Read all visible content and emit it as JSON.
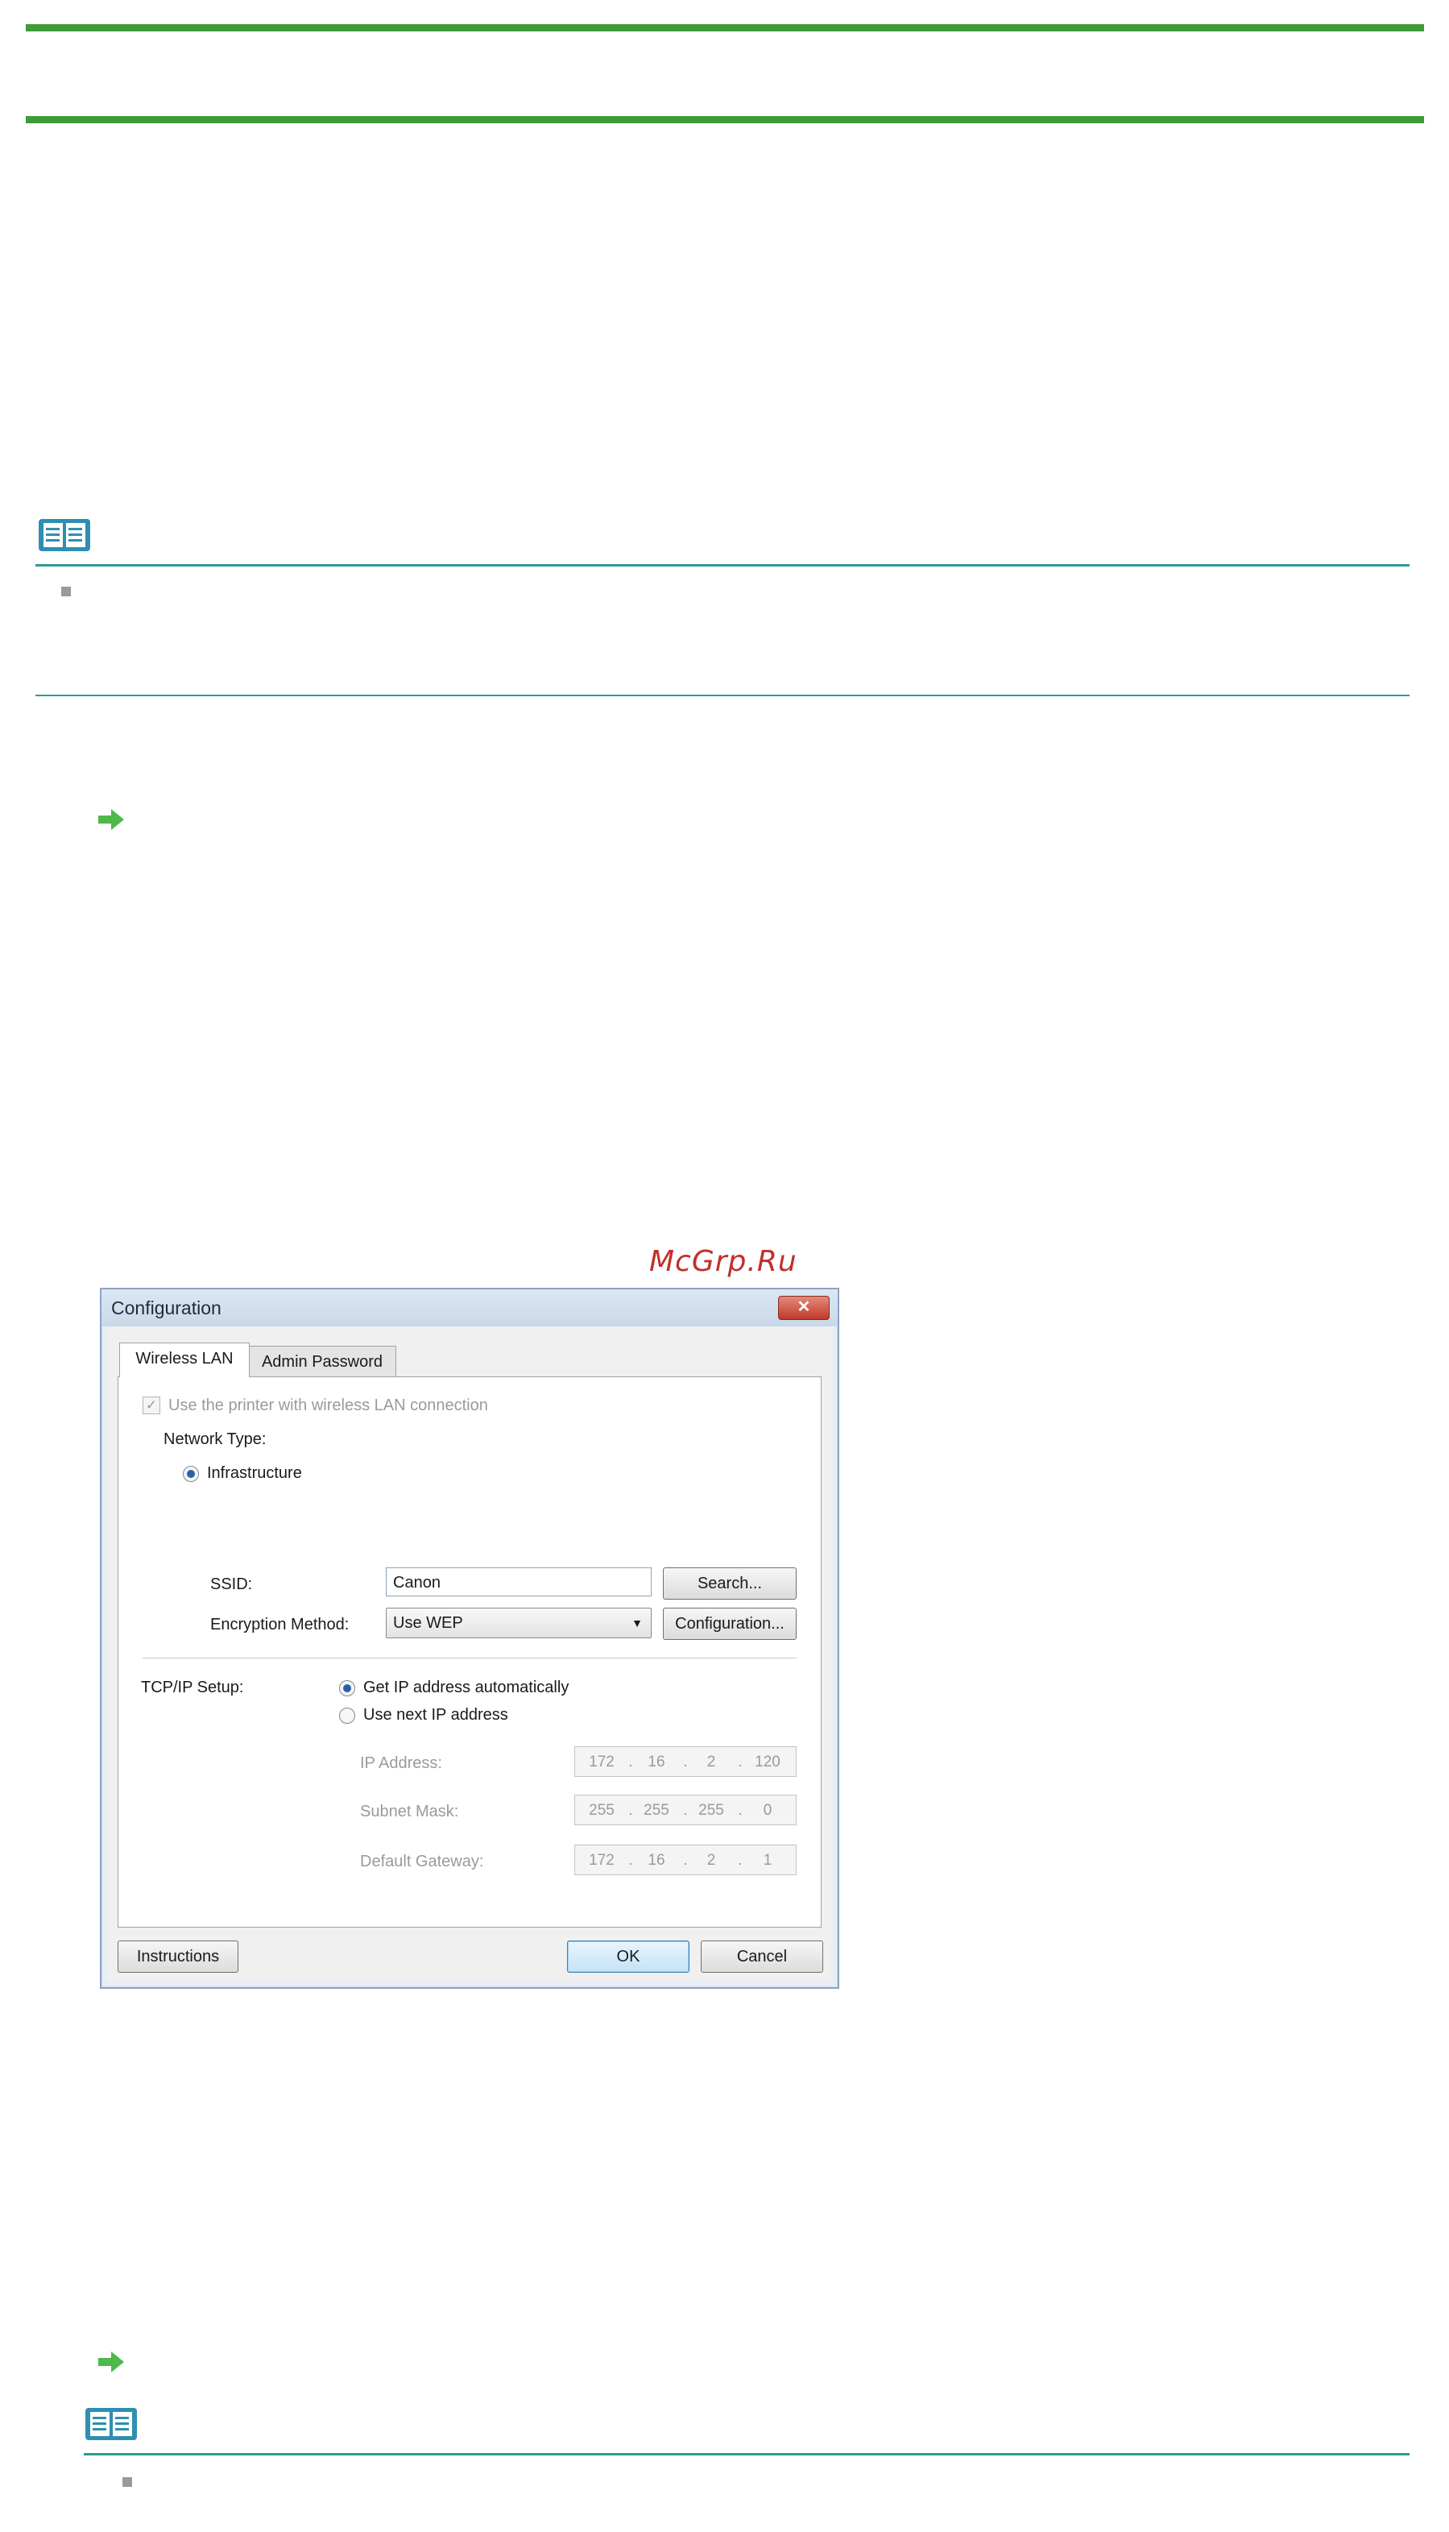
{
  "watermark": "McGrp.Ru",
  "dialog": {
    "title": "Configuration",
    "close_glyph": "✕",
    "tabs": [
      {
        "label": "Wireless LAN"
      },
      {
        "label": "Admin Password"
      }
    ],
    "wireless_checkbox_label": "Use the printer with wireless LAN connection",
    "wireless_checkbox_checked": true,
    "network_type_label": "Network Type:",
    "infrastructure_label": "Infrastructure",
    "ssid_label": "SSID:",
    "ssid_value": "Canon",
    "search_button": "Search...",
    "encryption_label": "Encryption Method:",
    "encryption_value": "Use WEP",
    "configuration_button": "Configuration...",
    "tcpip_label": "TCP/IP Setup:",
    "auto_ip_label": "Get IP address automatically",
    "next_ip_label": "Use next IP address",
    "ip_address_label": "IP Address:",
    "ip_address": [
      "172",
      "16",
      "2",
      "120"
    ],
    "subnet_label": "Subnet Mask:",
    "subnet_mask": [
      "255",
      "255",
      "255",
      "0"
    ],
    "gateway_label": "Default Gateway:",
    "gateway": [
      "172",
      "16",
      "2",
      "1"
    ],
    "instructions_button": "Instructions",
    "ok_button": "OK",
    "cancel_button": "Cancel"
  },
  "colors": {
    "accent_green": "#3f9a3a",
    "rule_teal": "#2f9a90",
    "watermark_red": "#c0302b"
  }
}
